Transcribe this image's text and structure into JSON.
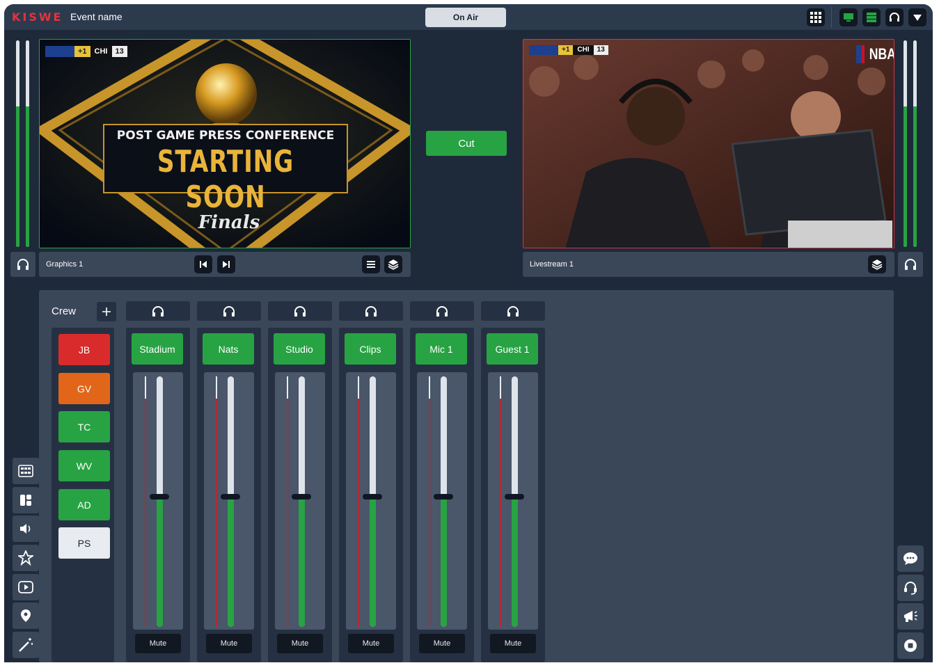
{
  "header": {
    "logo": "KISWE",
    "event_name": "Event name",
    "on_air_label": "On Air",
    "icons": [
      "grid-icon",
      "monitor-icon",
      "server-icon",
      "headset-icon",
      "chevron-down-icon"
    ]
  },
  "meters": {
    "left": {
      "level_a": 0.68,
      "level_b": 0.68
    },
    "right": {
      "level_a": 0.68,
      "level_b": 0.68
    }
  },
  "preview": {
    "scorebug": {
      "team_badge": "+1",
      "team": "CHI",
      "score": "13"
    },
    "headline_top": "POST GAME PRESS CONFERENCE",
    "headline_main": "STARTING SOON",
    "logo_text": "Finals",
    "source_label": "Graphics 1"
  },
  "program": {
    "scorebug": {
      "team_badge": "+1",
      "team": "CHI",
      "score": "13"
    },
    "logo_text": "NBA",
    "source_label": "Livestream 1"
  },
  "cut_label": "Cut",
  "crew": {
    "title": "Crew",
    "members": [
      {
        "label": "JB",
        "color": "#d92b2b"
      },
      {
        "label": "GV",
        "color": "#e2661a"
      },
      {
        "label": "TC",
        "color": "#27a343"
      },
      {
        "label": "WV",
        "color": "#27a343"
      },
      {
        "label": "AD",
        "color": "#27a343"
      },
      {
        "label": "PS",
        "color": "#e8ebef"
      }
    ]
  },
  "channels": [
    {
      "name": "Stadium",
      "level": 0.52,
      "mute_label": "Mute"
    },
    {
      "name": "Nats",
      "level": 0.52,
      "mute_label": "Mute"
    },
    {
      "name": "Studio",
      "level": 0.52,
      "mute_label": "Mute"
    },
    {
      "name": "Clips",
      "level": 0.52,
      "mute_label": "Mute"
    },
    {
      "name": "Mic 1",
      "level": 0.52,
      "mute_label": "Mute"
    },
    {
      "name": "Guest 1",
      "level": 0.52,
      "mute_label": "Mute"
    }
  ],
  "left_tools": [
    "multiview-icon",
    "layout-icon",
    "speaker-icon",
    "star-icon",
    "play-icon",
    "location-icon",
    "magic-wand-icon"
  ],
  "right_tools": [
    "chat-icon",
    "headset-icon",
    "megaphone-icon",
    "record-icon"
  ],
  "colors": {
    "accent_green": "#27a343",
    "accent_red": "#d63541",
    "brand": "#e5343d"
  }
}
